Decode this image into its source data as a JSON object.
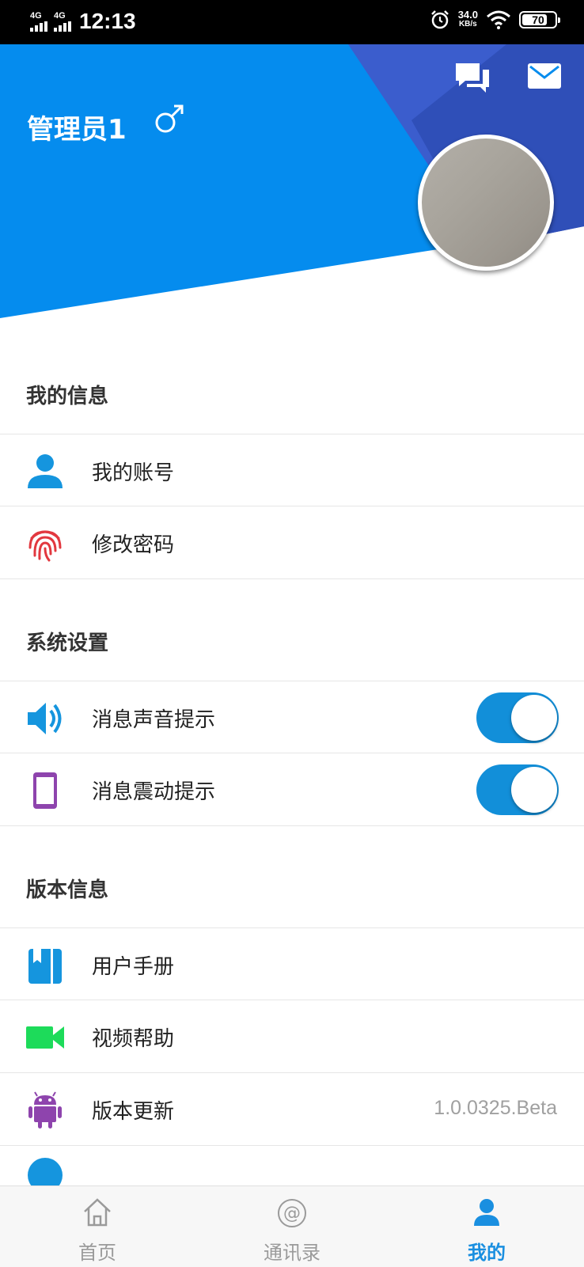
{
  "status_bar": {
    "network1": "4G",
    "network2": "4G",
    "time": "12:13",
    "speed_value": "34.0",
    "speed_unit": "KB/s",
    "battery": "70",
    "battery_level": 0.7
  },
  "header": {
    "user_name": "管理员1",
    "gender_icon": "male-symbol-icon",
    "chat_icon": "chat-bubbles-icon",
    "mail_icon": "mail-icon",
    "colors": {
      "blue": "#058cee",
      "dark_blue": "#2f4fb8",
      "mid_blue": "#3b5dcd"
    }
  },
  "sections": [
    {
      "title": "我的信息",
      "items": [
        {
          "label": "我的账号",
          "icon": "person-icon"
        },
        {
          "label": "修改密码",
          "icon": "fingerprint-icon"
        }
      ]
    },
    {
      "title": "系统设置",
      "items": [
        {
          "label": "消息声音提示",
          "icon": "speaker-icon",
          "toggle": true
        },
        {
          "label": "消息震动提示",
          "icon": "phone-vibrate-icon",
          "toggle": true
        }
      ]
    },
    {
      "title": "版本信息",
      "items": [
        {
          "label": "用户手册",
          "icon": "book-icon"
        },
        {
          "label": "视频帮助",
          "icon": "video-camera-icon"
        },
        {
          "label": "版本更新",
          "icon": "android-icon",
          "value": "1.0.0325.Beta"
        }
      ]
    }
  ],
  "tabbar": {
    "tabs": [
      {
        "label": "首页",
        "icon": "home-icon",
        "active": false
      },
      {
        "label": "通讯录",
        "icon": "at-sign-icon",
        "active": false
      },
      {
        "label": "我的",
        "icon": "person-icon",
        "active": true
      }
    ],
    "active_color": "#1a8fe0"
  }
}
